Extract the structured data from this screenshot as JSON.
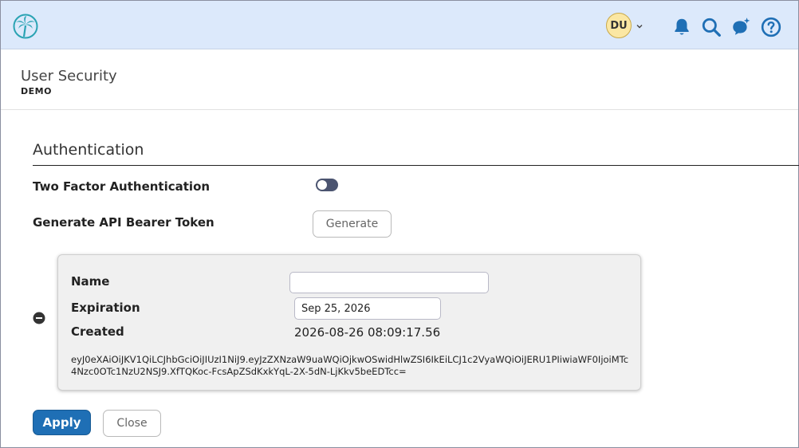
{
  "header": {
    "avatar_initials": "DU",
    "icons": [
      "palm-tree-logo",
      "chevron-down-icon",
      "bell-icon",
      "search-icon",
      "chat-sparkle-icon",
      "help-icon"
    ]
  },
  "page": {
    "title": "User Security",
    "subtitle": "DEMO"
  },
  "authentication": {
    "section_title": "Authentication",
    "two_factor_label": "Two Factor Authentication",
    "two_factor_enabled": false,
    "bearer_token_label": "Generate API Bearer Token",
    "generate_label": "Generate"
  },
  "token": {
    "name_label": "Name",
    "name_value": "",
    "expiration_label": "Expiration",
    "expiration_value": "Sep 25, 2026",
    "created_label": "Created",
    "created_value": "2026-08-26 08:09:17.56",
    "token_value": "eyJ0eXAiOiJKV1QiLCJhbGciOiJIUzI1NiJ9.eyJzZXNzaW9uaWQiOjkwOSwidHlwZSI6IkEiLCJ1c2VyaWQiOiJERU1PIiwiaWF0IjoiMTc4Nzc0OTc1NzU2NSJ9.XfTQKoc-FcsApZSdKxkYqL-2X-5dN-LjKkv5beEDTcc="
  },
  "actions": {
    "apply_label": "Apply",
    "close_label": "Close"
  },
  "colors": {
    "header_bg": "#dce9fb",
    "primary": "#1f6fb5",
    "toggle_off": "#4b5470",
    "logo_teal": "#2aa3b3"
  }
}
